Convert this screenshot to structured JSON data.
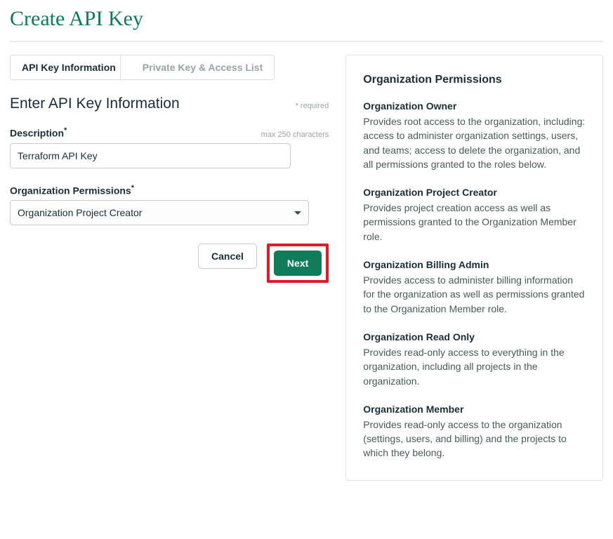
{
  "page": {
    "title": "Create API Key"
  },
  "tabs": {
    "active": "API Key Information",
    "inactive": "Private Key & Access List"
  },
  "form": {
    "header": "Enter API Key Information",
    "required_hint": "* required",
    "description": {
      "label": "Description",
      "char_hint": "max 250 characters",
      "value": "Terraform API Key"
    },
    "org_permissions": {
      "label": "Organization Permissions",
      "selected": "Organization Project Creator"
    },
    "buttons": {
      "cancel": "Cancel",
      "next": "Next"
    }
  },
  "panel": {
    "title": "Organization Permissions",
    "items": [
      {
        "title": "Organization Owner",
        "desc": "Provides root access to the organization, including: access to administer organization settings, users, and teams; access to delete the organization, and all permissions granted to the roles below."
      },
      {
        "title": "Organization Project Creator",
        "desc": "Provides project creation access as well as permissions granted to the Organization Member role."
      },
      {
        "title": "Organization Billing Admin",
        "desc": "Provides access to administer billing information for the organization as well as permissions granted to the Organization Member role."
      },
      {
        "title": "Organization Read Only",
        "desc": "Provides read-only access to everything in the organization, including all projects in the organization."
      },
      {
        "title": "Organization Member",
        "desc": "Provides read-only access to the organization (settings, users, and billing) and the projects to which they belong."
      }
    ]
  }
}
